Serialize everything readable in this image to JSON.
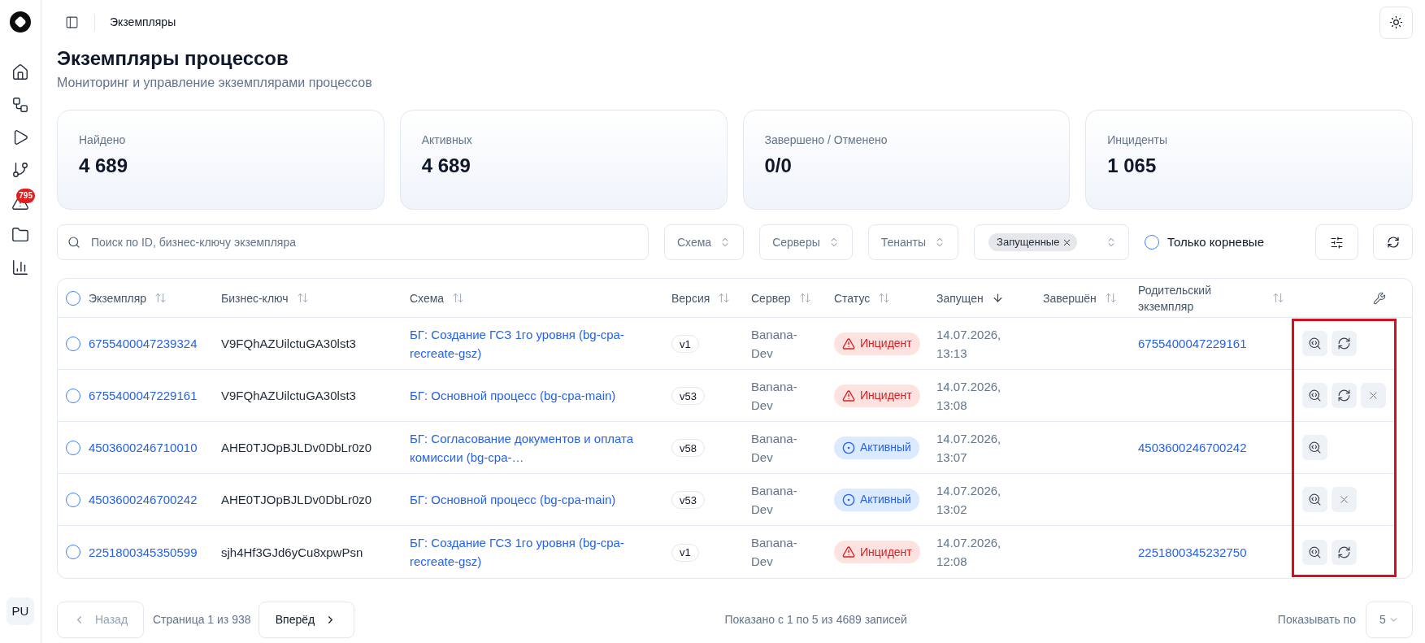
{
  "sidebar": {
    "items": [
      {
        "kind": "home",
        "selected": false
      },
      {
        "kind": "workflow",
        "selected": false
      },
      {
        "kind": "play",
        "selected": false
      },
      {
        "kind": "branch",
        "selected": false
      },
      {
        "kind": "alert",
        "selected": false,
        "badge": "795"
      },
      {
        "kind": "folder",
        "selected": false
      },
      {
        "kind": "chart",
        "selected": false
      }
    ],
    "avatar": "PU"
  },
  "header": {
    "breadcrumb": "Экземпляры"
  },
  "page": {
    "title": "Экземпляры процессов",
    "subtitle": "Мониторинг и управление экземплярами процессов"
  },
  "stats": [
    {
      "label": "Найдено",
      "value": "4 689"
    },
    {
      "label": "Активных",
      "value": "4 689"
    },
    {
      "label": "Завершено / Отменено",
      "value": "0/0"
    },
    {
      "label": "Инциденты",
      "value": "1 065"
    }
  ],
  "filters": {
    "search": {
      "placeholder": "Поиск по ID, бизнес-ключу экземпляра"
    },
    "selects": [
      {
        "label": "Схема"
      },
      {
        "label": "Серверы"
      },
      {
        "label": "Тенанты"
      }
    ],
    "status_select": {
      "chips": [
        "Запущенные"
      ]
    },
    "root_only": {
      "label": "Только корневые",
      "checked": false
    }
  },
  "table": {
    "select_all_checked": false,
    "actions_highlighted": true,
    "columns": [
      {
        "label": "Экземпляр",
        "sorted": false
      },
      {
        "label": "Бизнес-ключ",
        "sorted": false
      },
      {
        "label": "Схема",
        "sorted": false
      },
      {
        "label": "Версия",
        "sorted": false
      },
      {
        "label": "Сервер",
        "sorted": false
      },
      {
        "label": "Статус",
        "sorted": false
      },
      {
        "label": "Запущен",
        "sorted": true
      },
      {
        "label": "Завершён",
        "sorted": false
      },
      {
        "label": "Родительский экземпляр",
        "sorted": false
      }
    ],
    "rows": [
      {
        "checked": false,
        "instance": "6755400047239324",
        "business_key": "V9FQhAZUilctuGA30lst3",
        "schema": "БГ: Создание ГСЗ 1го уровня (bg-cpa-recreate-gsz)",
        "version": "v1",
        "server": "Banana-Dev",
        "status": {
          "kind": "incident",
          "label": "Инцидент"
        },
        "started": "14.07.2026, 13:13",
        "parent": "6755400047229161",
        "actions": [
          {
            "kind": "view"
          },
          {
            "kind": "retry"
          }
        ]
      },
      {
        "checked": false,
        "instance": "6755400047229161",
        "business_key": "V9FQhAZUilctuGA30lst3",
        "schema": "БГ: Основной процесс (bg-cpa-main)",
        "version": "v53",
        "server": "Banana-Dev",
        "status": {
          "kind": "incident",
          "label": "Инцидент"
        },
        "started": "14.07.2026, 13:08",
        "actions": [
          {
            "kind": "view"
          },
          {
            "kind": "retry"
          },
          {
            "kind": "cancel"
          }
        ]
      },
      {
        "checked": false,
        "instance": "4503600246710010",
        "business_key": "AHE0TJOpBJLDv0DbLr0z0",
        "schema": "БГ: Согласование документов и оплата комиссии (bg-cpa-…",
        "version": "v58",
        "server": "Banana-Dev",
        "status": {
          "kind": "active",
          "label": "Активный"
        },
        "started": "14.07.2026, 13:07",
        "parent": "4503600246700242",
        "actions": [
          {
            "kind": "view"
          }
        ]
      },
      {
        "checked": false,
        "instance": "4503600246700242",
        "business_key": "AHE0TJOpBJLDv0DbLr0z0",
        "schema": "БГ: Основной процесс (bg-cpa-main)",
        "version": "v53",
        "server": "Banana-Dev",
        "status": {
          "kind": "active",
          "label": "Активный"
        },
        "started": "14.07.2026, 13:02",
        "actions": [
          {
            "kind": "view"
          },
          {
            "kind": "cancel"
          }
        ]
      },
      {
        "checked": false,
        "instance": "2251800345350599",
        "business_key": "sjh4Hf3GJd6yCu8xpwPsn",
        "schema": "БГ: Создание ГСЗ 1го уровня (bg-cpa-recreate-gsz)",
        "version": "v1",
        "server": "Banana-Dev",
        "status": {
          "kind": "incident",
          "label": "Инцидент"
        },
        "started": "14.07.2026, 12:08",
        "parent": "2251800345232750",
        "actions": [
          {
            "kind": "view"
          },
          {
            "kind": "retry"
          }
        ]
      }
    ]
  },
  "pagination": {
    "prev": {
      "label": "Назад",
      "disabled": true
    },
    "page_info": "Страница 1 из 938",
    "next": {
      "label": "Вперёд",
      "disabled": false
    },
    "summary": "Показано с 1 по 5 из 4689 записей",
    "page_size_label": "Показывать по",
    "page_size": "5"
  }
}
